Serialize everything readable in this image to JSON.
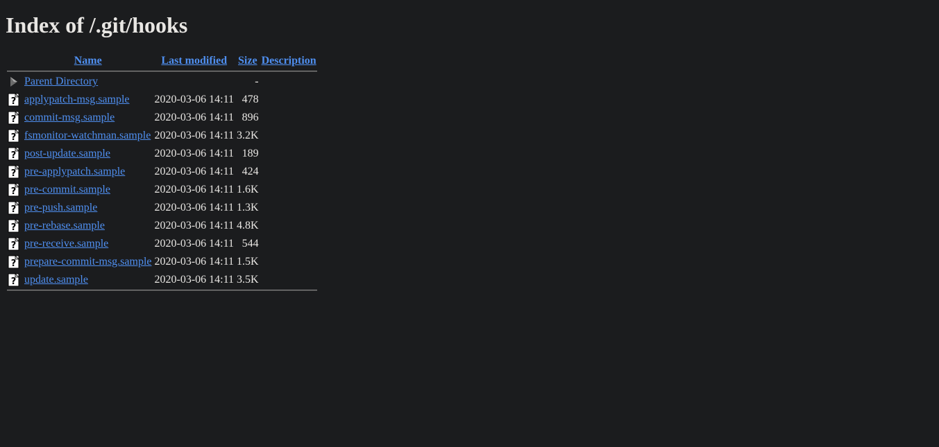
{
  "page": {
    "title": "Index of /.git/hooks"
  },
  "columns": {
    "name": "Name",
    "last_modified": "Last modified",
    "size": "Size",
    "description": "Description"
  },
  "parent": {
    "label": "Parent Directory",
    "size": "-",
    "icon": "back-icon"
  },
  "files": [
    {
      "name": "applypatch-msg.sample",
      "modified": "2020-03-06 14:11",
      "size": "478",
      "icon": "unknown-file-icon"
    },
    {
      "name": "commit-msg.sample",
      "modified": "2020-03-06 14:11",
      "size": "896",
      "icon": "unknown-file-icon"
    },
    {
      "name": "fsmonitor-watchman.sample",
      "modified": "2020-03-06 14:11",
      "size": "3.2K",
      "icon": "unknown-file-icon"
    },
    {
      "name": "post-update.sample",
      "modified": "2020-03-06 14:11",
      "size": "189",
      "icon": "unknown-file-icon"
    },
    {
      "name": "pre-applypatch.sample",
      "modified": "2020-03-06 14:11",
      "size": "424",
      "icon": "unknown-file-icon"
    },
    {
      "name": "pre-commit.sample",
      "modified": "2020-03-06 14:11",
      "size": "1.6K",
      "icon": "unknown-file-icon"
    },
    {
      "name": "pre-push.sample",
      "modified": "2020-03-06 14:11",
      "size": "1.3K",
      "icon": "unknown-file-icon"
    },
    {
      "name": "pre-rebase.sample",
      "modified": "2020-03-06 14:11",
      "size": "4.8K",
      "icon": "unknown-file-icon"
    },
    {
      "name": "pre-receive.sample",
      "modified": "2020-03-06 14:11",
      "size": "544",
      "icon": "unknown-file-icon"
    },
    {
      "name": "prepare-commit-msg.sample",
      "modified": "2020-03-06 14:11",
      "size": "1.5K",
      "icon": "unknown-file-icon"
    },
    {
      "name": "update.sample",
      "modified": "2020-03-06 14:11",
      "size": "3.5K",
      "icon": "unknown-file-icon"
    }
  ],
  "colors": {
    "background": "#1b1c1e",
    "text": "#e8e6e3",
    "link": "#4f8ff0"
  }
}
